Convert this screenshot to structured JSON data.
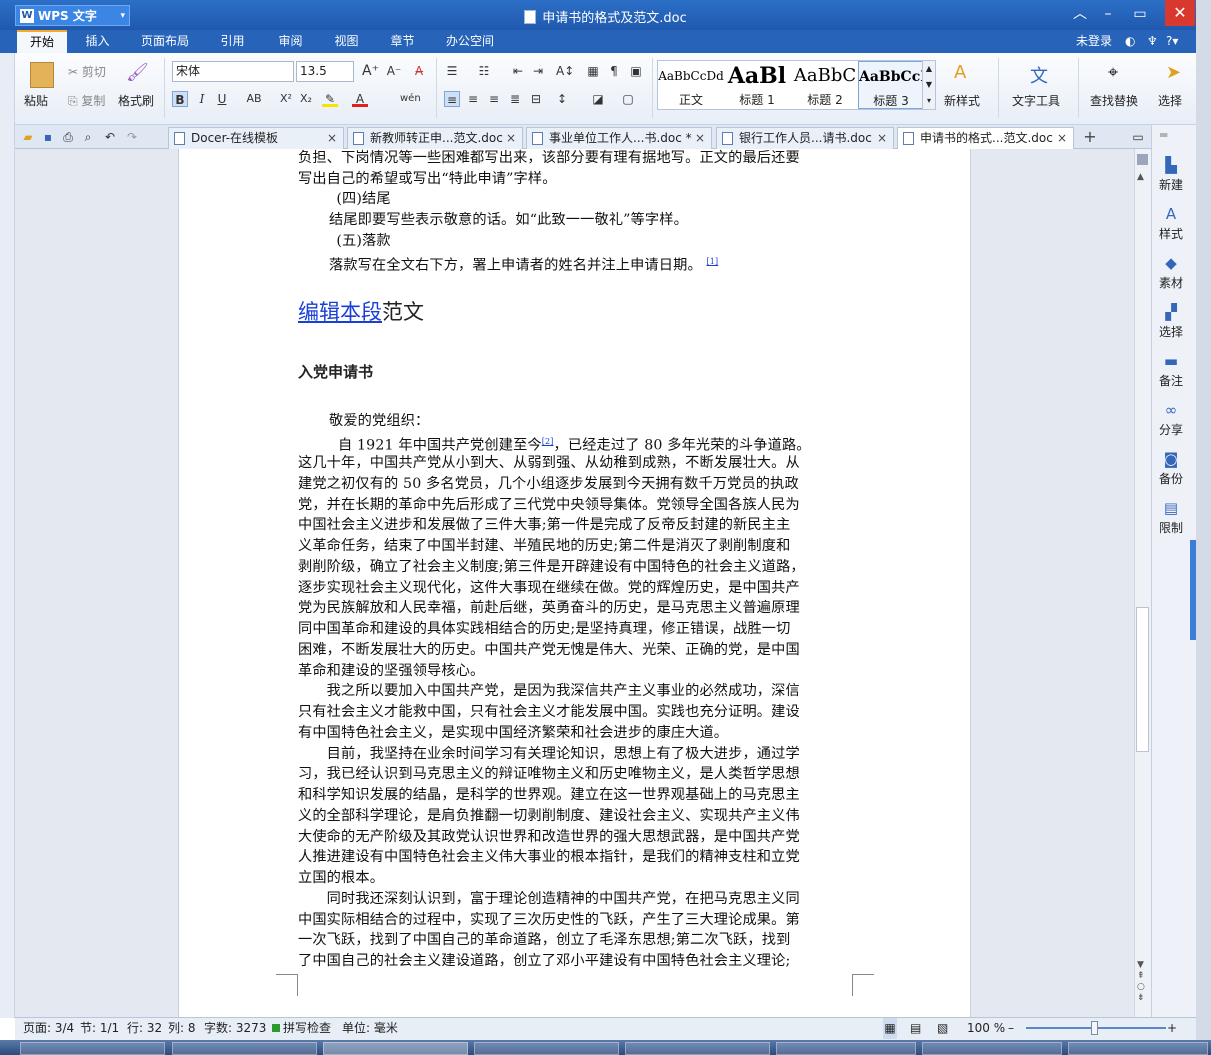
{
  "window": {
    "app_button": "WPS 文字",
    "doc_title": "申请书的格式及范文.doc"
  },
  "menu": {
    "items": [
      "开始",
      "插入",
      "页面布局",
      "引用",
      "审阅",
      "视图",
      "章节",
      "办公空间"
    ],
    "login": "未登录"
  },
  "ribbon": {
    "paste": "粘贴",
    "cut": "剪切",
    "copy": "复制",
    "format_painter": "格式刷",
    "font_name": "宋体",
    "font_size": "13.5",
    "styles": [
      {
        "preview": "AaBbCcDd",
        "name": "正文"
      },
      {
        "preview": "AaBl",
        "name": "标题 1"
      },
      {
        "preview": "AaBbC",
        "name": "标题 2"
      },
      {
        "preview": "AaBbCcI",
        "name": "标题 3"
      }
    ],
    "new_style": "新样式",
    "text_tools": "文字工具",
    "find_replace": "查找替换",
    "select": "选择"
  },
  "tabs": [
    {
      "label": "Docer-在线模板"
    },
    {
      "label": "新教师转正申...范文.doc"
    },
    {
      "label": "事业单位工作人...书.doc *"
    },
    {
      "label": "银行工作人员...请书.doc"
    },
    {
      "label": "申请书的格式...范文.doc"
    }
  ],
  "document": {
    "lines_top": [
      "负担、下岗情况等一些困难都写出来，该部分要有理有据地写。正文的最后还要",
      "写出自己的希望或写出“特此申请”字样。",
      "　(四)结尾",
      "结尾即要写些表示敬意的话。如“此致一一敬礼”等字样。",
      "　(五)落款",
      "落款写在全文右下方，署上申请者的姓名并注上申请日期。"
    ],
    "ref1": "[1]",
    "heading_link": "编辑本段",
    "heading_rest": "范文",
    "subheading": "入党申请书",
    "salutation": "敬爱的党组织：",
    "first_line_pre": "自 1921 年中国共产党创建至今",
    "ref2": "[2]",
    "first_line_post": "，已经走过了 80 多年光荣的斗争道路。",
    "body_lines": [
      "这几十年，中国共产党从小到大、从弱到强、从幼稚到成熟，不断发展壮大。从",
      "建党之初仅有的 50 多名党员，几个小组逐步发展到今天拥有数千万党员的执政",
      "党，并在长期的革命中先后形成了三代党中央领导集体。党领导全国各族人民为",
      "中国社会主义进步和发展做了三件大事;第一件是完成了反帝反封建的新民主主",
      "义革命任务，结束了中国半封建、半殖民地的历史;第二件是消灭了剥削制度和",
      "剥削阶级，确立了社会主义制度;第三件是开辟建设有中国特色的社会主义道路，",
      "逐步实现社会主义现代化，这件大事现在继续在做。党的辉煌历史，是中国共产",
      "党为民族解放和人民幸福，前赴后继，英勇奋斗的历史，是马克思主义普遍原理",
      "同中国革命和建设的具体实践相结合的历史;是坚持真理，修正错误，战胜一切",
      "困难，不断发展壮大的历史。中国共产党无愧是伟大、光荣、正确的党，是中国",
      "革命和建设的坚强领导核心。",
      "　　我之所以要加入中国共产党，是因为我深信共产主义事业的必然成功，深信",
      "只有社会主义才能救中国，只有社会主义才能发展中国。实践也充分证明。建设",
      "有中国特色社会主义，是实现中国经济繁荣和社会进步的康庄大道。",
      "　　目前，我坚持在业余时间学习有关理论知识，思想上有了极大进步，通过学",
      "习，我已经认识到马克思主义的辩证唯物主义和历史唯物主义，是人类哲学思想",
      "和科学知识发展的结晶，是科学的世界观。建立在这一世界观基础上的马克思主",
      "义的全部科学理论，是肩负推翻一切剥削制度、建设社会主义、实现共产主义伟",
      "大使命的无产阶级及其政党认识世界和改造世界的强大思想武器，是中国共产党",
      "人推进建设有中国特色社会主义伟大事业的根本指针，是我们的精神支柱和立党",
      "立国的根本。",
      "　　同时我还深刻认识到，富于理论创造精神的中国共产党，在把马克思主义同",
      "中国实际相结合的过程中，实现了三次历史性的飞跃，产生了三大理论成果。第",
      "一次飞跃，找到了中国自己的革命道路，创立了毛泽东思想;第二次飞跃，找到",
      "了中国自己的社会主义建设道路，创立了邓小平建设有中国特色社会主义理论;"
    ]
  },
  "right_panel": [
    "新建",
    "样式",
    "素材",
    "选择",
    "备注",
    "分享",
    "备份",
    "限制"
  ],
  "status": {
    "page": "页面: 3/4",
    "section": "节: 1/1",
    "row": "行: 32",
    "col": "列: 8",
    "words": "字数: 3273",
    "spell": "拼写检查",
    "unit": "单位: 毫米",
    "zoom": "100 %"
  },
  "colors": {
    "accent": "#2763b9",
    "link": "#1a3fd6",
    "close": "#d8382d"
  }
}
